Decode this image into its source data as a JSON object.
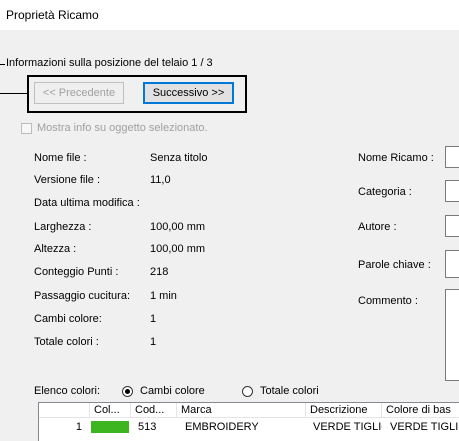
{
  "window": {
    "title": "Proprietà Ricamo"
  },
  "frame_info": {
    "label": "Informazioni sulla posizione del telaio 1 / 3"
  },
  "nav": {
    "prev_label": "<< Precedente",
    "next_label": "Successivo >>"
  },
  "show_selected": {
    "label": "Mostra info su oggetto selezionato."
  },
  "info": [
    {
      "label": "Nome file :",
      "value": "Senza titolo"
    },
    {
      "label": "Versione file :",
      "value": "11,0"
    },
    {
      "label": "Data ultima modifica :",
      "value": ""
    },
    {
      "label": "Larghezza :",
      "value": "100,00 mm"
    },
    {
      "label": "Altezza :",
      "value": "100,00 mm"
    },
    {
      "label": "Conteggio Punti :",
      "value": "218"
    },
    {
      "label": "Passaggio cucitura:",
      "value": "1 min"
    },
    {
      "label": "Cambi colore:",
      "value": "1"
    },
    {
      "label": "Totale colori :",
      "value": "1"
    }
  ],
  "right_fields": {
    "nome_ricamo": "Nome Ricamo :",
    "categoria": "Categoria :",
    "autore": "Autore :",
    "parole_chiave": "Parole chiave :",
    "commento": "Commento :"
  },
  "color_list": {
    "label": "Elenco colori:",
    "option_changes": "Cambi colore",
    "option_total": "Totale colori",
    "selected": "Cambi colore"
  },
  "table": {
    "columns": [
      "Col...",
      "Cod...",
      "Marca",
      "Descrizione",
      "Colore di bas"
    ],
    "rows": [
      {
        "index": "1",
        "color": "#3cb521",
        "code": "513",
        "brand": "EMBROIDERY",
        "description": "VERDE TIGLIO",
        "base": "VERDE TIGLI"
      }
    ]
  }
}
